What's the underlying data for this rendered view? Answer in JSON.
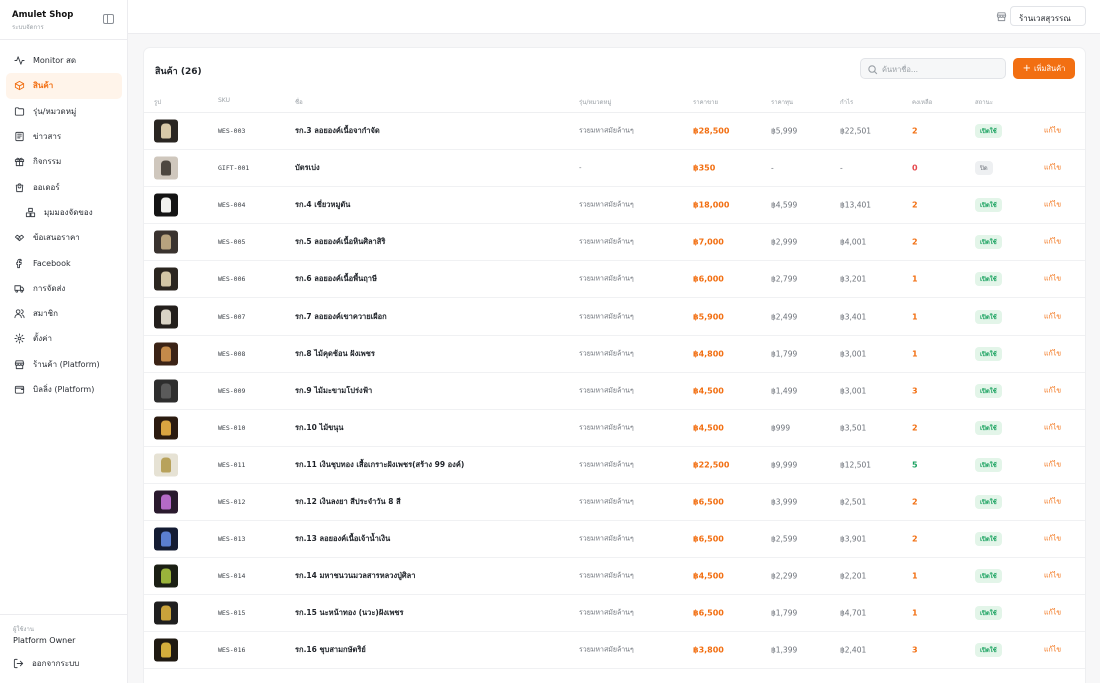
{
  "brand": {
    "name": "Amulet Shop",
    "subtitle": "ระบบจัดการ"
  },
  "nav": [
    {
      "label": "Monitor สด",
      "icon": "activity-icon",
      "active": false,
      "sub": false
    },
    {
      "label": "สินค้า",
      "icon": "box-icon",
      "active": true,
      "sub": false
    },
    {
      "label": "รุ่น/หมวดหมู่",
      "icon": "folder-icon",
      "active": false,
      "sub": false
    },
    {
      "label": "ข่าวสาร",
      "icon": "newspaper-icon",
      "active": false,
      "sub": false
    },
    {
      "label": "กิจกรรม",
      "icon": "gift-icon",
      "active": false,
      "sub": false
    },
    {
      "label": "ออเดอร์",
      "icon": "shopping-bag-icon",
      "active": false,
      "sub": false
    },
    {
      "label": "มุมมองจัดของ",
      "icon": "boxes-icon",
      "active": false,
      "sub": true
    },
    {
      "label": "ข้อเสนอราคา",
      "icon": "handshake-icon",
      "active": false,
      "sub": false
    },
    {
      "label": "Facebook",
      "icon": "facebook-icon",
      "active": false,
      "sub": false
    },
    {
      "label": "การจัดส่ง",
      "icon": "truck-icon",
      "active": false,
      "sub": false
    },
    {
      "label": "สมาชิก",
      "icon": "users-icon",
      "active": false,
      "sub": false
    },
    {
      "label": "ตั้งค่า",
      "icon": "gear-icon",
      "active": false,
      "sub": false
    },
    {
      "label": "ร้านค้า (Platform)",
      "icon": "store-icon",
      "active": false,
      "sub": false
    },
    {
      "label": "บิลลิ่ง (Platform)",
      "icon": "wallet-icon",
      "active": false,
      "sub": false
    }
  ],
  "user": {
    "label": "ผู้ใช้งาน",
    "name": "Platform Owner"
  },
  "logout_label": "ออกจากระบบ",
  "topbar": {
    "store_name": "ร้านเวสสุวรรณ"
  },
  "products": {
    "title": "สินค้า (26)",
    "search_placeholder": "ค้นหาชื่อ...",
    "add_label": "เพิ่มสินค้า",
    "columns": [
      "รูป",
      "SKU",
      "ชื่อ",
      "รุ่น/หมวดหมู่",
      "ราคาขาย",
      "ราคาทุน",
      "กำไร",
      "คงเหลือ",
      "สถานะ"
    ],
    "edit_label": "แก้ไข",
    "rows": [
      {
        "sku": "WES-003",
        "name": "รก.3 ลอยองค์เนื้อจากำจัด",
        "group": "รวยมหาสมัยล้านๆ",
        "price": "฿28,500",
        "cost": "฿5,999",
        "profit": "฿22,501",
        "stock": "2",
        "stock_color": "orange",
        "status": "เปิดใช้",
        "active": true
      },
      {
        "sku": "GIFT-001",
        "name": "บัตรเบ่ง",
        "group": "-",
        "price": "฿350",
        "cost": "-",
        "profit": "-",
        "stock": "0",
        "stock_color": "red",
        "status": "ปิด",
        "active": false
      },
      {
        "sku": "WES-004",
        "name": "รก.4 เชี่ยวหมูตัน",
        "group": "รวยมหาสมัยล้านๆ",
        "price": "฿18,000",
        "cost": "฿4,599",
        "profit": "฿13,401",
        "stock": "2",
        "stock_color": "orange",
        "status": "เปิดใช้",
        "active": true
      },
      {
        "sku": "WES-005",
        "name": "รก.5 ลอยองค์เนื้อหินศิลาสิริ",
        "group": "รวยมหาสมัยล้านๆ",
        "price": "฿7,000",
        "cost": "฿2,999",
        "profit": "฿4,001",
        "stock": "2",
        "stock_color": "orange",
        "status": "เปิดใช้",
        "active": true
      },
      {
        "sku": "WES-006",
        "name": "รก.6 ลอยองค์เนื้อพื้นฤาษี",
        "group": "รวยมหาสมัยล้านๆ",
        "price": "฿6,000",
        "cost": "฿2,799",
        "profit": "฿3,201",
        "stock": "1",
        "stock_color": "orange",
        "status": "เปิดใช้",
        "active": true
      },
      {
        "sku": "WES-007",
        "name": "รก.7 ลอยองค์เขาควายเผือก",
        "group": "รวยมหาสมัยล้านๆ",
        "price": "฿5,900",
        "cost": "฿2,499",
        "profit": "฿3,401",
        "stock": "1",
        "stock_color": "orange",
        "status": "เปิดใช้",
        "active": true
      },
      {
        "sku": "WES-008",
        "name": "รก.8 ไม้คุดช้อน ฝังเพชร",
        "group": "รวยมหาสมัยล้านๆ",
        "price": "฿4,800",
        "cost": "฿1,799",
        "profit": "฿3,001",
        "stock": "1",
        "stock_color": "orange",
        "status": "เปิดใช้",
        "active": true
      },
      {
        "sku": "WES-009",
        "name": "รก.9 ไม้มะขามโปร่งฟ้า",
        "group": "รวยมหาสมัยล้านๆ",
        "price": "฿4,500",
        "cost": "฿1,499",
        "profit": "฿3,001",
        "stock": "3",
        "stock_color": "orange",
        "status": "เปิดใช้",
        "active": true
      },
      {
        "sku": "WES-010",
        "name": "รก.10 ไม้ขนุน",
        "group": "รวยมหาสมัยล้านๆ",
        "price": "฿4,500",
        "cost": "฿999",
        "profit": "฿3,501",
        "stock": "2",
        "stock_color": "orange",
        "status": "เปิดใช้",
        "active": true
      },
      {
        "sku": "WES-011",
        "name": "รก.11 เงินชุบทอง เสื้อเกราะฝังเพชร(สร้าง 99 องค์)",
        "group": "รวยมหาสมัยล้านๆ",
        "price": "฿22,500",
        "cost": "฿9,999",
        "profit": "฿12,501",
        "stock": "5",
        "stock_color": "green",
        "status": "เปิดใช้",
        "active": true
      },
      {
        "sku": "WES-012",
        "name": "รก.12 เงินลงยา สีประจำวัน 8 สี",
        "group": "รวยมหาสมัยล้านๆ",
        "price": "฿6,500",
        "cost": "฿3,999",
        "profit": "฿2,501",
        "stock": "2",
        "stock_color": "orange",
        "status": "เปิดใช้",
        "active": true
      },
      {
        "sku": "WES-013",
        "name": "รก.13 ลอยองค์เนื้อเจ้าน้ำเงิน",
        "group": "รวยมหาสมัยล้านๆ",
        "price": "฿6,500",
        "cost": "฿2,599",
        "profit": "฿3,901",
        "stock": "2",
        "stock_color": "orange",
        "status": "เปิดใช้",
        "active": true
      },
      {
        "sku": "WES-014",
        "name": "รก.14 มหาชนวนมวลสารหลวงปู่ศิลา",
        "group": "รวยมหาสมัยล้านๆ",
        "price": "฿4,500",
        "cost": "฿2,299",
        "profit": "฿2,201",
        "stock": "1",
        "stock_color": "orange",
        "status": "เปิดใช้",
        "active": true
      },
      {
        "sku": "WES-015",
        "name": "รก.15 นะหน้าทอง (นวะ)ฝังเพชร",
        "group": "รวยมหาสมัยล้านๆ",
        "price": "฿6,500",
        "cost": "฿1,799",
        "profit": "฿4,701",
        "stock": "1",
        "stock_color": "orange",
        "status": "เปิดใช้",
        "active": true
      },
      {
        "sku": "WES-016",
        "name": "รก.16 ชุบสามกษัตริย์",
        "group": "รวยมหาสมัยล้านๆ",
        "price": "฿3,800",
        "cost": "฿1,399",
        "profit": "฿2,401",
        "stock": "3",
        "stock_color": "orange",
        "status": "เปิดใช้",
        "active": true
      }
    ]
  },
  "colors": {
    "accent": "#f26f12",
    "success": "#1aa260",
    "danger": "#e5484d"
  }
}
